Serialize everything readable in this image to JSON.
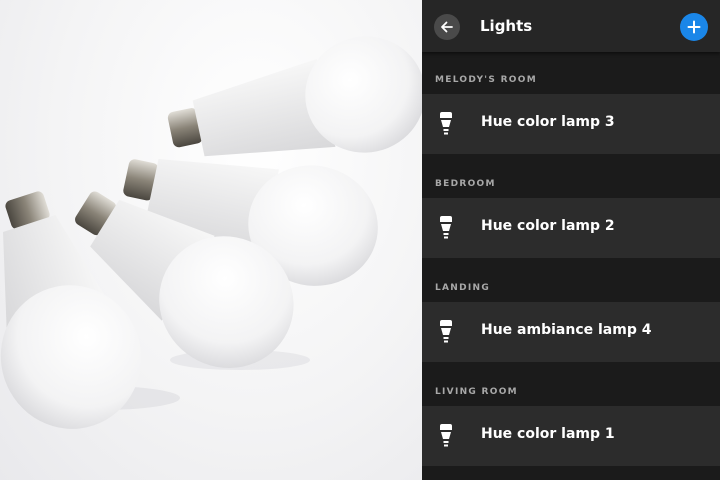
{
  "app": {
    "title": "Lights",
    "back_icon": "back-arrow-icon",
    "add_icon": "plus-icon",
    "accent_color": "#1a86e8"
  },
  "photo": {
    "subject": "light-bulbs-photo"
  },
  "rooms": [
    {
      "name": "MELODY'S ROOM",
      "lights": [
        {
          "label": "Hue color lamp 3",
          "icon": "bulb-icon"
        }
      ]
    },
    {
      "name": "BEDROOM",
      "lights": [
        {
          "label": "Hue color lamp 2",
          "icon": "bulb-icon"
        }
      ]
    },
    {
      "name": "LANDING",
      "lights": [
        {
          "label": "Hue ambiance lamp 4",
          "icon": "bulb-icon"
        }
      ]
    },
    {
      "name": "LIVING ROOM",
      "lights": [
        {
          "label": "Hue color lamp 1",
          "icon": "bulb-icon"
        }
      ]
    }
  ]
}
